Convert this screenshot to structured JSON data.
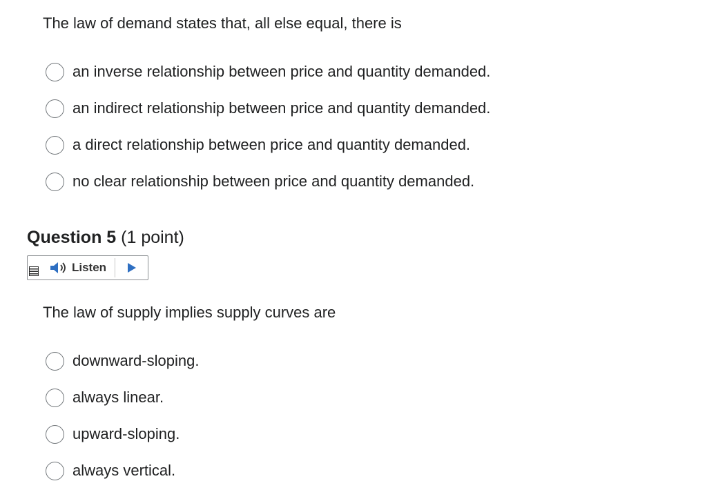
{
  "question4": {
    "stem": "The law of demand states that, all else equal, there is",
    "options": [
      "an inverse relationship between price and quantity demanded.",
      "an indirect relationship between price and quantity demanded.",
      "a direct relationship between price and quantity demanded.",
      "no clear relationship between price and quantity demanded."
    ]
  },
  "question5": {
    "title": "Question 5",
    "points": "(1 point)",
    "listen_label": "Listen",
    "stem": "The law of supply implies supply curves are",
    "options": [
      "downward-sloping.",
      "always linear.",
      "upward-sloping.",
      "always vertical."
    ]
  },
  "icons": {
    "menu": "menu-icon",
    "speaker": "speaker-icon",
    "play": "play-icon",
    "radio": "radio-unchecked-icon"
  },
  "colors": {
    "text": "#202122",
    "radio_border": "#6f7478",
    "widget_border": "#8a8d90"
  }
}
